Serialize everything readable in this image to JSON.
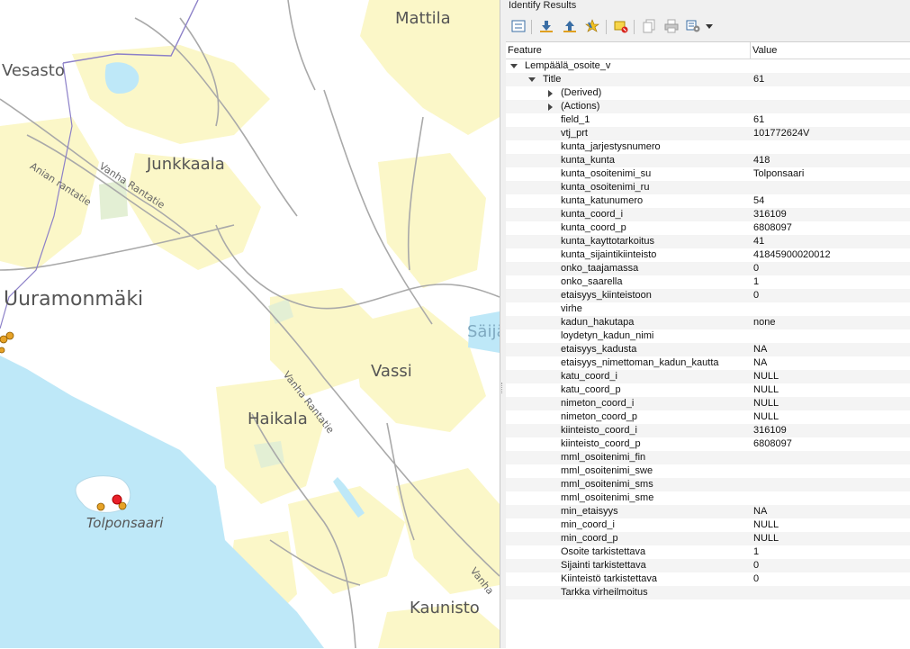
{
  "map": {
    "labels": {
      "vesasto": "Vesasto",
      "mattila": "Mattila",
      "junkkaala": "Junkkaala",
      "uuramonmaki": "Uuramonmäki",
      "saija": "Säijä",
      "vassi": "Vassi",
      "haikala": "Haikala",
      "tolponsaari": "Tolponsaari",
      "kaunisto": "Kaunisto",
      "road_anian": "Anian rantatie",
      "road_vanha_top": "Vanha Rantatie",
      "road_vanha_mid": "Vanha Rantatie",
      "road_vanha_bottom": "Vanha"
    },
    "colors": {
      "water": "#bee8f8",
      "field": "#fbf7c8",
      "road": "#a9a9a9",
      "boundary": "#8c80c8",
      "point": "#e6a227",
      "selected": "#e8202a"
    }
  },
  "panel": {
    "title": "Identify Results",
    "toolbar_icons": [
      "expand-icon",
      "collapse-icon",
      "expand-all-icon",
      "select-icon",
      "clear-highlight-icon",
      "copy-icon",
      "print-icon",
      "settings-icon",
      "dropdown-arrow-icon"
    ],
    "headers": {
      "feature": "Feature",
      "value": "Value"
    },
    "layer_name": "Lempäälä_osoite_v",
    "title_row": {
      "name": "Title",
      "value": "61"
    },
    "derived": "(Derived)",
    "actions": "(Actions)",
    "attributes": [
      {
        "name": "field_1",
        "value": "61"
      },
      {
        "name": "vtj_prt",
        "value": "101772624V"
      },
      {
        "name": "kunta_jarjestysnumero",
        "value": ""
      },
      {
        "name": "kunta_kunta",
        "value": "418"
      },
      {
        "name": "kunta_osoitenimi_su",
        "value": "Tolponsaari"
      },
      {
        "name": "kunta_osoitenimi_ru",
        "value": ""
      },
      {
        "name": "kunta_katunumero",
        "value": "54"
      },
      {
        "name": "kunta_coord_i",
        "value": "316109"
      },
      {
        "name": "kunta_coord_p",
        "value": "6808097"
      },
      {
        "name": "kunta_kayttotarkoitus",
        "value": "41"
      },
      {
        "name": "kunta_sijaintikiinteisto",
        "value": "41845900020012"
      },
      {
        "name": "onko_taajamassa",
        "value": "0"
      },
      {
        "name": "onko_saarella",
        "value": "1"
      },
      {
        "name": "etaisyys_kiinteistoon",
        "value": "0"
      },
      {
        "name": "virhe",
        "value": ""
      },
      {
        "name": "kadun_hakutapa",
        "value": "none"
      },
      {
        "name": "loydetyn_kadun_nimi",
        "value": ""
      },
      {
        "name": "etaisyys_kadusta",
        "value": "NA"
      },
      {
        "name": "etaisyys_nimettoman_kadun_kautta",
        "value": "NA"
      },
      {
        "name": "katu_coord_i",
        "value": "NULL"
      },
      {
        "name": "katu_coord_p",
        "value": "NULL"
      },
      {
        "name": "nimeton_coord_i",
        "value": "NULL"
      },
      {
        "name": "nimeton_coord_p",
        "value": "NULL"
      },
      {
        "name": "kiinteisto_coord_i",
        "value": "316109"
      },
      {
        "name": "kiinteisto_coord_p",
        "value": "6808097"
      },
      {
        "name": "mml_osoitenimi_fin",
        "value": ""
      },
      {
        "name": "mml_osoitenimi_swe",
        "value": ""
      },
      {
        "name": "mml_osoitenimi_sms",
        "value": ""
      },
      {
        "name": "mml_osoitenimi_sme",
        "value": ""
      },
      {
        "name": "min_etaisyys",
        "value": "NA"
      },
      {
        "name": "min_coord_i",
        "value": "NULL"
      },
      {
        "name": "min_coord_p",
        "value": "NULL"
      },
      {
        "name": "Osoite tarkistettava",
        "value": "1"
      },
      {
        "name": "Sijainti tarkistettava",
        "value": "0"
      },
      {
        "name": "Kiinteistö tarkistettava",
        "value": "0"
      },
      {
        "name": "Tarkka virheilmoitus",
        "value": ""
      }
    ]
  }
}
